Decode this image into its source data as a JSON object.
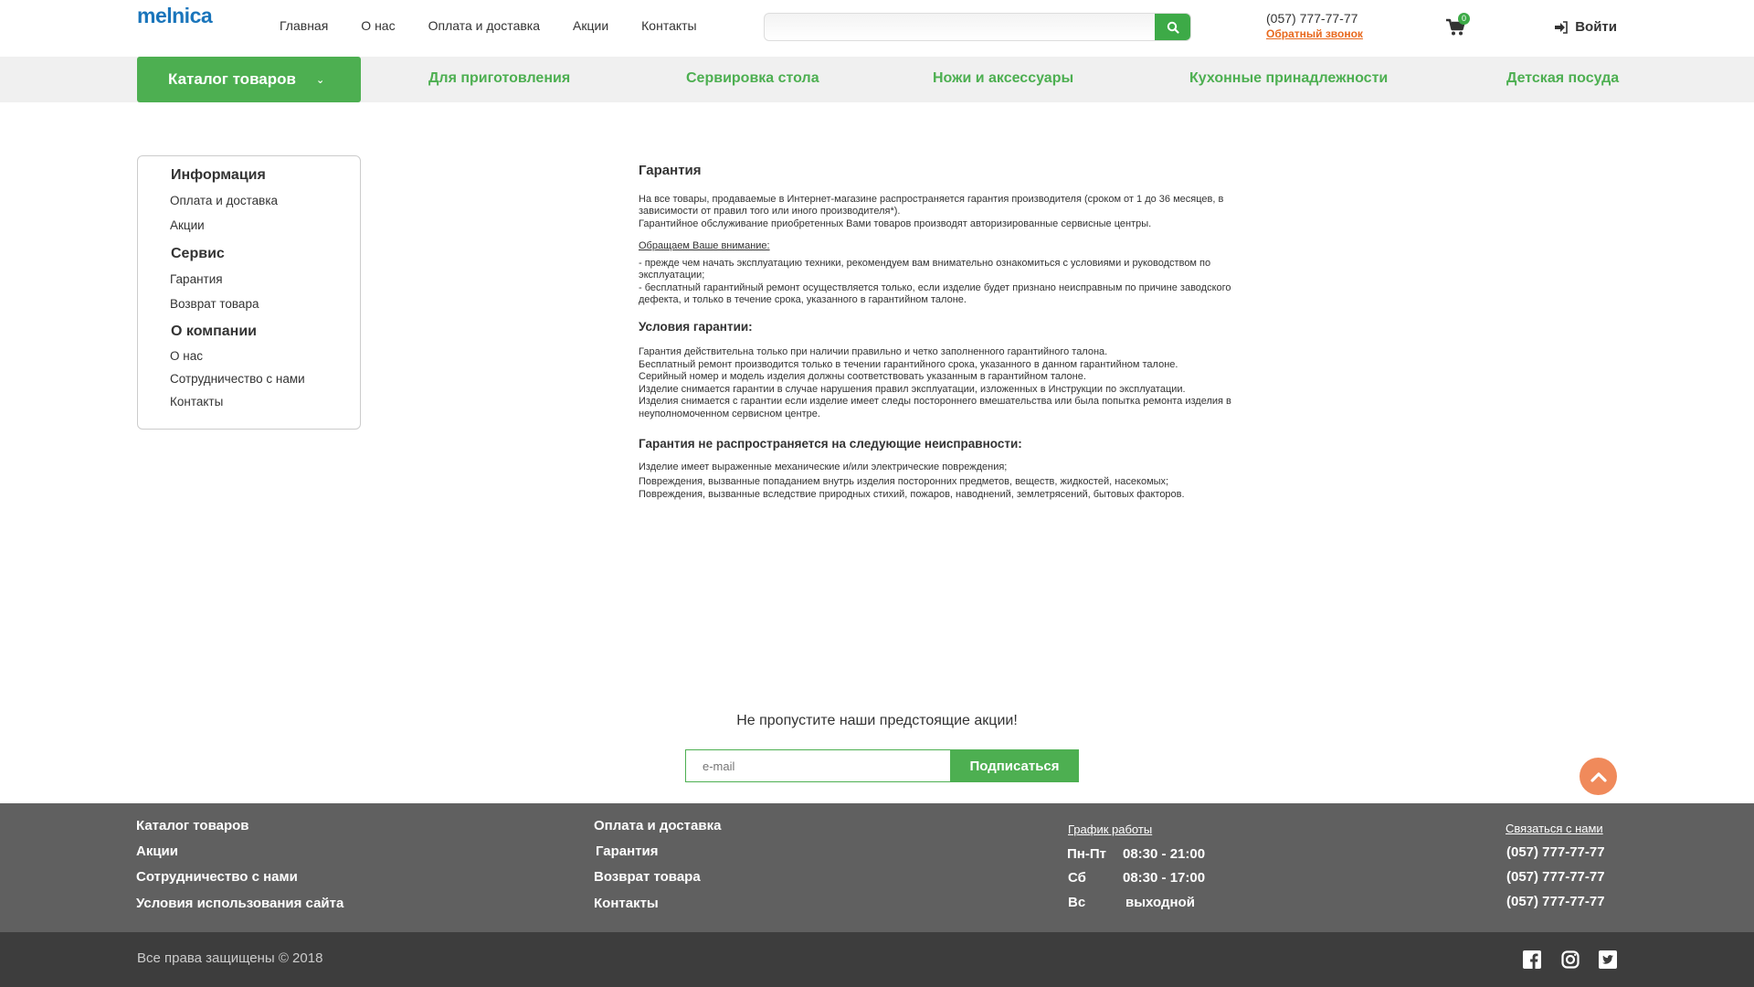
{
  "header": {
    "logo": "melnica",
    "nav": [
      "Главная",
      "О нас",
      "Оплата и доставка",
      "Акции",
      "Контакты"
    ],
    "search_placeholder": "",
    "phone": "(057) 777-77-77",
    "callback": "Обратный звонок",
    "cart_count": "0",
    "login": "Войти"
  },
  "catbar": {
    "catalog": "Каталог товаров",
    "categories": [
      "Для приготовления",
      "Сервировка стола",
      "Ножи и аксессуары",
      "Кухонные принадлежности",
      "Детская посуда"
    ]
  },
  "sidebar": {
    "sections": [
      {
        "title": "Информация",
        "items": [
          "Оплата и доставка",
          "Акции"
        ]
      },
      {
        "title": "Сервис",
        "items": [
          "Гарантия",
          "Возврат товара"
        ]
      },
      {
        "title": "О компании",
        "items": [
          "О нас",
          "Сотрудничество с нами",
          "Контакты"
        ]
      }
    ]
  },
  "main": {
    "title": "Гарантия",
    "intro1": "На все товары, продаваемые в Интернет-магазине распространяется гарантия производителя (сроком от 1 до 36 месяцев, в зависимости от правил того или иного производителя*).",
    "intro2": "Гарантийное обслуживание приобретенных Вами товаров производят авторизированные сервисные центры.",
    "attention": "Обращаем Ваше внимание:",
    "note1": "- прежде чем начать эксплуатацию техники, рекомендуем вам внимательно ознакомиться с условиями и руководством по эксплуатации;",
    "note2": "- бесплатный гарантийный ремонт осуществляется только, если изделие будет признано неисправным по причине заводского дефекта, и только в течение срока, указанного в гарантийном талоне.",
    "conditions_title": "Условия гарантии:",
    "conditions": [
      "Гарантия действительна только при наличии правильно и четко заполненного гарантийного талона.",
      "Бесплатный ремонт производится только в течении гарантийного срока, указанного в данном гарантийном талоне.",
      "Серийный номер и модель изделия должны соответствовать указанным в гарантийном талоне.",
      "Изделие снимается гарантии в случае нарушения правил эксплуатации, изложенных в Инструкции по эксплуатации.",
      "Изделия снимается с гарантии если изделие имеет следы постороннего вмешательства или была попытка ремонта изделия в неуполномоченном сервисном центре."
    ],
    "exclusions_title": "Гарантия не распространяется на следующие неисправности:",
    "exclusions": [
      "Изделие имеет выраженные механические и/или электрические повреждения;",
      "Повреждения, вызванные попаданием внутрь изделия посторонних предметов, веществ, жидкостей, насекомых;",
      "Повреждения, вызванные вследствие природных стихий, пожаров, наводнений, землетрясений, бытовых факторов."
    ]
  },
  "subscribe": {
    "title": "Не пропустите наши предстоящие акции!",
    "placeholder": "e-mail",
    "button": "Подписаться"
  },
  "footer": {
    "col1": [
      "Каталог товаров",
      "Акции",
      "Сотрудничество с нами",
      "Условия использования сайта"
    ],
    "col2": [
      "Оплата и доставка",
      "Гарантия",
      "Возврат товара",
      "Контакты"
    ],
    "schedule_title": "График работы",
    "schedule": [
      {
        "day": "Пн-Пт",
        "time": "08:30 - 21:00"
      },
      {
        "day": "Сб",
        "time": "08:30 - 17:00"
      },
      {
        "day": "Вс",
        "time": "выходной"
      }
    ],
    "contact_title": "Связаться с нами",
    "phones": [
      "(057) 777-77-77",
      "(057) 777-77-77",
      "(057) 777-77-77"
    ],
    "copyright": "Все права защищены © 2018"
  },
  "colors": {
    "green": "#4daf51",
    "orange": "#e8691e",
    "footer": "#606060",
    "bottom": "#3d3d3d"
  }
}
